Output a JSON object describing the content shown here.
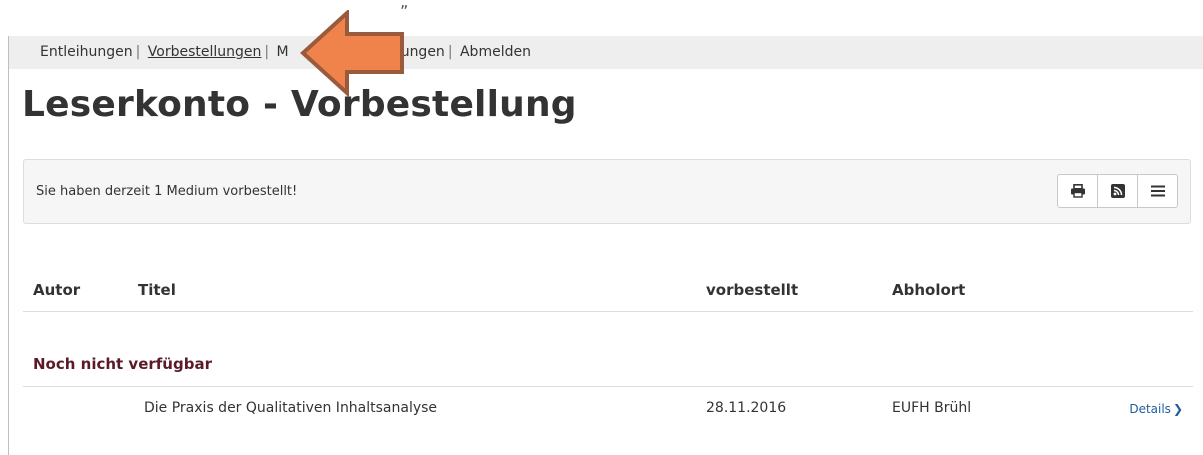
{
  "top_fragment": "„",
  "nav": {
    "items": [
      {
        "label": "Entleihungen",
        "active": false
      },
      {
        "label": "Vorbestellungen",
        "active": true
      },
      {
        "label": "M",
        "active": false
      },
      {
        "label": "nstellungen",
        "active": false
      },
      {
        "label": "Abmelden",
        "active": false
      }
    ],
    "separator": "|"
  },
  "page_title": "Leserkonto - Vorbestellung",
  "info": {
    "text": "Sie haben derzeit 1 Medium vorbestellt!",
    "buttons": [
      {
        "icon": "print-icon"
      },
      {
        "icon": "rss-icon"
      },
      {
        "icon": "menu-icon"
      }
    ]
  },
  "table": {
    "headers": [
      "Autor",
      "Titel",
      "vorbestellt",
      "Abholort"
    ],
    "group_heading": "Noch nicht verfügbar",
    "rows": [
      {
        "autor": "",
        "titel": "Die Praxis der Qualitativen Inhaltsanalyse",
        "vorbestellt": "28.11.2016",
        "abholort": "EUFH Brühl",
        "details_label": "Details",
        "details_icon": "chevron-right-icon"
      }
    ]
  },
  "colors": {
    "nav_bg": "#eeeeee",
    "arrow_fill": "#f0824c",
    "arrow_stroke": "#9a5a3c",
    "group_heading": "#5a1a2a",
    "link": "#1f5e9c"
  }
}
